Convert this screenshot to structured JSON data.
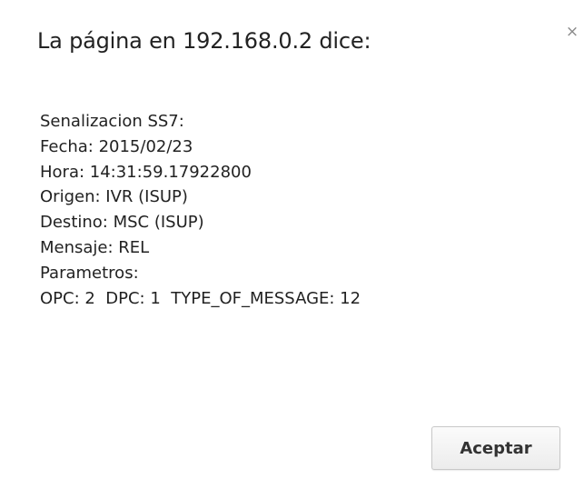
{
  "dialog": {
    "title": "La página en 192.168.0.2 dice:",
    "close_glyph": "×",
    "message_lines": [
      "Senalizacion SS7:",
      "Fecha: 2015/02/23",
      "Hora: 14:31:59.17922800",
      "Origen: IVR (ISUP)",
      "Destino: MSC (ISUP)",
      "Mensaje: REL",
      "Parametros:",
      "OPC: 2  DPC: 1  TYPE_OF_MESSAGE: 12"
    ],
    "ok_label": "Aceptar"
  }
}
